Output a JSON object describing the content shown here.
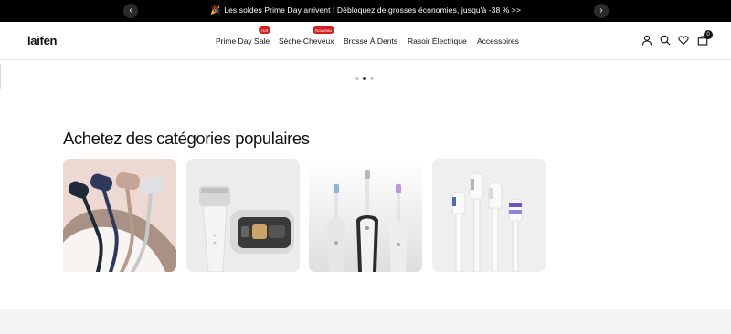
{
  "announcement": {
    "text": "Les soldes Prime Day arrivent ! Débloquez de grosses économies, jusqu'à -38 % >>",
    "emoji": "🎉"
  },
  "header": {
    "logo": "laifen",
    "nav": [
      {
        "label": "Prime Day Sale",
        "badge": "Hot"
      },
      {
        "label": "Sèche-Cheveux",
        "badge": "Nouveau"
      },
      {
        "label": "Brosse À Dents"
      },
      {
        "label": "Rasoir Électrique"
      },
      {
        "label": "Accessoires"
      }
    ],
    "cart_count": "0",
    "icons": [
      "account-icon",
      "search-icon",
      "heart-icon",
      "cart-icon"
    ]
  },
  "carousel": {
    "dots": 3,
    "active": 1
  },
  "categories": {
    "title": "Achetez des catégories populaires",
    "cards": [
      {
        "name": "hair-dryers"
      },
      {
        "name": "electric-shaver"
      },
      {
        "name": "electric-toothbrushes"
      },
      {
        "name": "brush-heads"
      }
    ]
  },
  "colors": {
    "badge": "#d62020",
    "announcement_bg": "#000000"
  }
}
